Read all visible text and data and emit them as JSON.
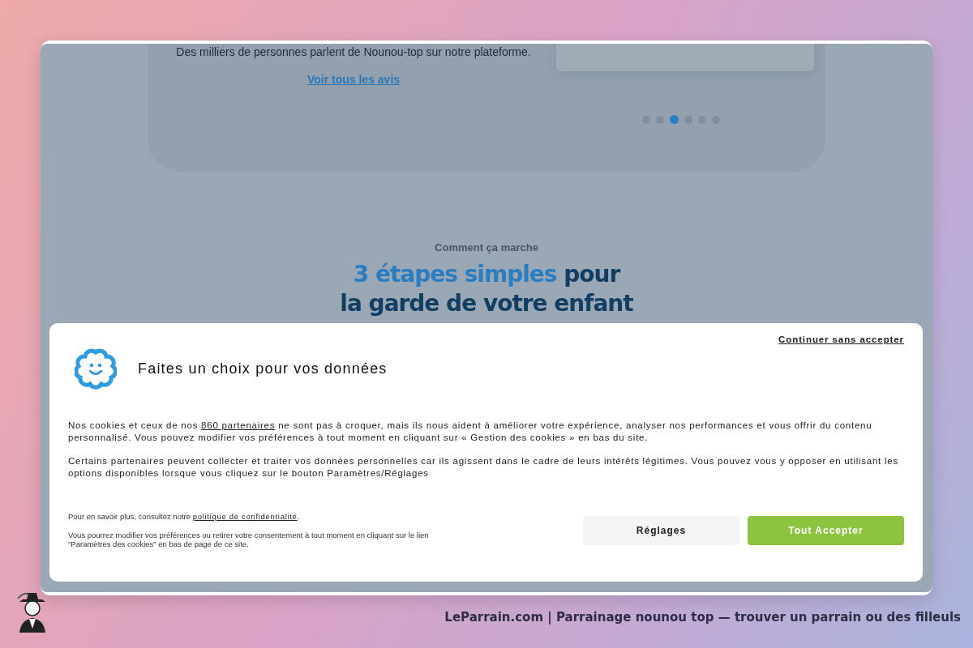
{
  "page": {
    "reviews_text": "Des milliers de personnes parlent de Nounou-top sur notre plateforme.",
    "reviews_link": "Voir tous les avis",
    "carousel_dots": [
      {
        "selected": false
      },
      {
        "selected": false
      },
      {
        "selected": true
      },
      {
        "selected": false
      },
      {
        "selected": false
      },
      {
        "selected": false
      }
    ],
    "eyebrow": "Comment ça marche",
    "headline": {
      "highlight": "3 étapes simples",
      "rest": " pour",
      "line2": "la garde de votre enfant"
    }
  },
  "cookie_dialog": {
    "continue_link": "Continuer sans accepter",
    "title": "Faites un choix pour vos données",
    "paragraph_1": {
      "before": "Nos cookies et ceux de nos ",
      "link": "860 partenaires",
      "after": " ne sont pas à croquer, mais ils nous aident à améliorer votre expérience, analyser nos performances et vous offrir du contenu personnalisé. Vous pouvez modifier vos préférences à tout moment en cliquant sur « Gestion des cookies » en bas du site."
    },
    "paragraph_2": "Certains partenaires peuvent collecter et traiter vos données personnelles car ils agissent dans le cadre de leurs intérêts légitimes. Vous pouvez vous y opposer en utilisant les options disponibles lorsque vous cliquez sur le bouton Paramètres/Réglages",
    "privacy_note": {
      "before": "Pour en savoir plus, consultez notre ",
      "link": "politique de confidentialité",
      "after": "."
    },
    "settings_note": "Vous pourrez modifier vos préférences ou retirer votre consentement à tout moment en cliquant sur le lien \"Paramètres des cookies\" en bas de page de ce site.",
    "buttons": [
      {
        "label": "Réglages",
        "kind": "secondary"
      },
      {
        "label": "Tout Accepter",
        "kind": "primary"
      }
    ]
  },
  "footer": {
    "caption": "LeParrain.com | Parrainage nounou top — trouver un parrain ou des filleuls"
  }
}
